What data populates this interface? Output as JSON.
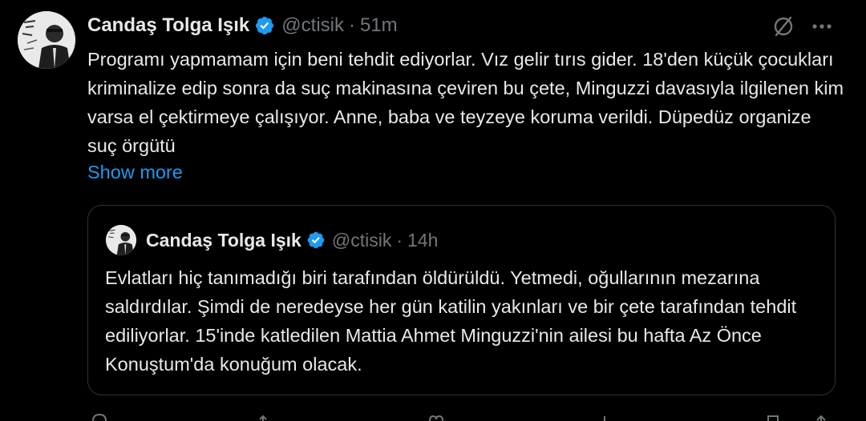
{
  "tweet": {
    "author_name": "Candaş Tolga Işık",
    "handle": "@ctisik",
    "separator": "·",
    "time": "51m",
    "body": "Programı yapmamam için beni tehdit ediyorlar. Vız gelir tırıs gider. 18'den küçük çocukları kriminalize edip sonra da suç makinasına çeviren bu çete, Minguzzi davasıyla ilgilenen kim varsa el çektirmeye çalışıyor. Anne, baba ve teyzeye koruma verildi. Düpedüz organize suç örgütü",
    "show_more": "Show more",
    "icons": {
      "verified": "verified-badge-icon",
      "grok": "grok-icon",
      "more": "more-options-icon"
    }
  },
  "quote": {
    "author_name": "Candaş Tolga Işık",
    "handle": "@ctisik",
    "separator": "·",
    "time": "14h",
    "body": "Evlatları hiç tanımadığı biri tarafından öldürüldü. Yetmedi, oğullarının mezarına saldırdılar. Şimdi de neredeyse her gün katilin yakınları ve bir çete tarafından tehdit ediliyorlar. 15'inde katledilen Mattia Ahmet Minguzzi'nin ailesi bu hafta Az Önce Konuştum'da konuğum olacak."
  },
  "colors": {
    "background": "#000000",
    "text": "#e7e9ea",
    "muted": "#71767b",
    "accent": "#1d9bf0",
    "border": "#2f3336"
  }
}
